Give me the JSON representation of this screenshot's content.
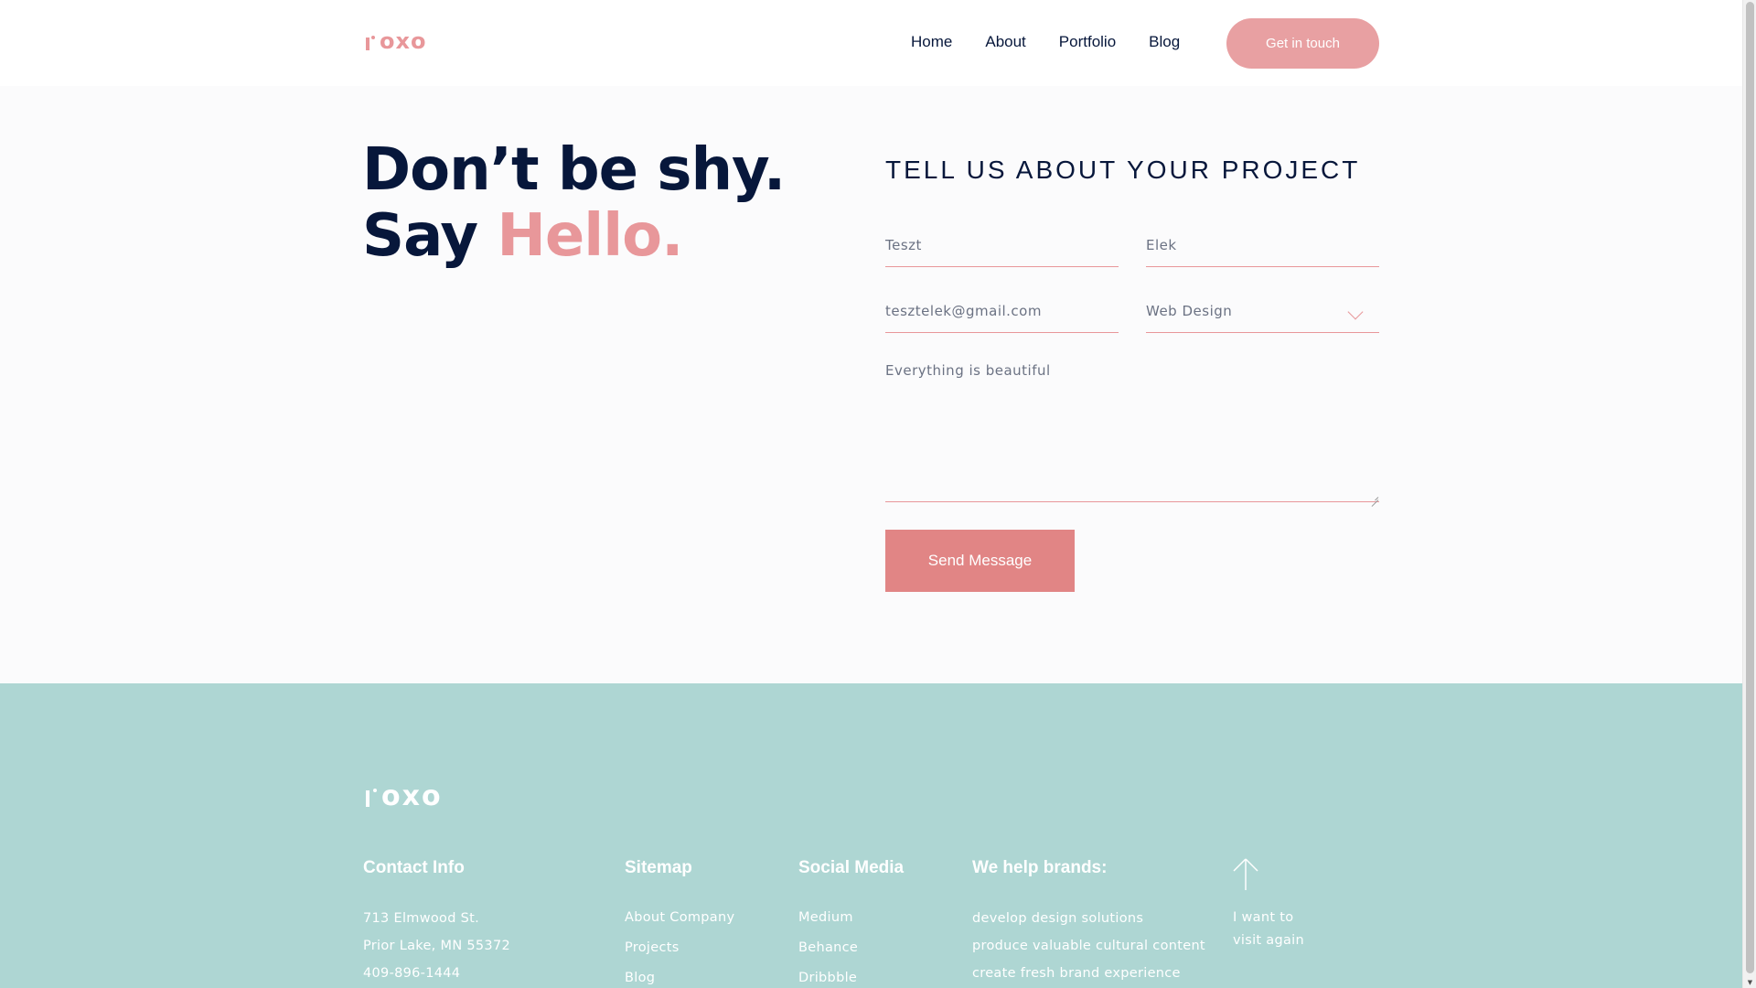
{
  "colors": {
    "accent": "#e8979a",
    "navy": "#07173b",
    "footer_bg": "#aed6d3",
    "send_button": "#e18585"
  },
  "header": {
    "logo_text": "oxo",
    "nav": [
      "Home",
      "About",
      "Portfolio",
      "Blog"
    ],
    "cta_label": "Get in touch"
  },
  "hero": {
    "line1": "Don’t be shy.",
    "line2_plain": "Say ",
    "line2_accent": "Hello."
  },
  "form": {
    "title": "TELL US ABOUT YOUR PROJECT",
    "first_name": "Teszt",
    "last_name": "Elek",
    "email": "tesztelek@gmail.com",
    "service": "Web Design",
    "message": "Everything is beautiful",
    "submit_label": "Send Message"
  },
  "footer": {
    "logo_text": "oxo",
    "contact": {
      "title": "Contact Info",
      "lines": [
        "713 Elmwood St.",
        "Prior Lake, MN 55372",
        "409-896-1444"
      ]
    },
    "sitemap": {
      "title": "Sitemap",
      "links": [
        "About Company",
        "Projects",
        "Blog"
      ]
    },
    "social": {
      "title": "Social Media",
      "links": [
        "Medium",
        "Behance",
        "Dribbble"
      ]
    },
    "brands": {
      "title": "We help brands:",
      "lines": [
        "develop design solutions",
        "produce valuable cultural content",
        "create fresh brand experience"
      ]
    },
    "back_to_top": {
      "line1": "I want to",
      "line2": "visit again"
    }
  }
}
